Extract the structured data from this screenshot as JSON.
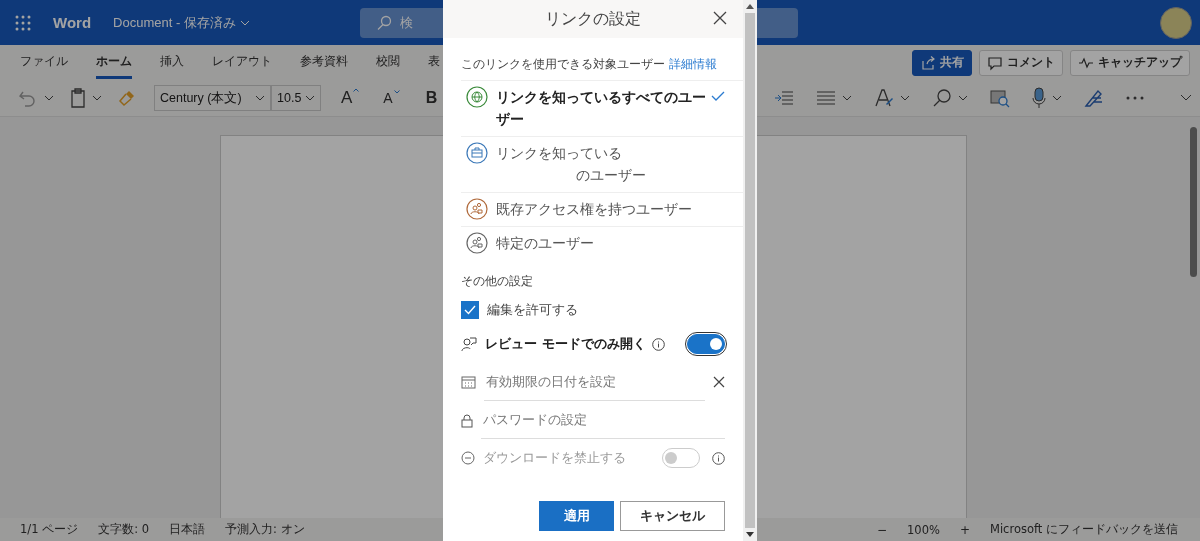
{
  "app": {
    "name": "Word",
    "document": "Document",
    "separator": "-",
    "status": "保存済み",
    "search_placeholder": "検"
  },
  "ribbon_tabs": [
    {
      "label": "ファイル",
      "selected": false
    },
    {
      "label": "ホーム",
      "selected": true
    },
    {
      "label": "挿入",
      "selected": false
    },
    {
      "label": "レイアウト",
      "selected": false
    },
    {
      "label": "参考資料",
      "selected": false
    },
    {
      "label": "校閲",
      "selected": false
    },
    {
      "label": "表",
      "selected": false
    }
  ],
  "ribbon_buttons": [
    {
      "label": "共有",
      "kind": "primary"
    },
    {
      "label": "コメント",
      "kind": "comment"
    },
    {
      "label": "キャッチアップ",
      "kind": "catchup"
    }
  ],
  "toolbar": {
    "font": "Century (本文)",
    "size": "10.5",
    "grow_font": "A",
    "shrink_font": "A",
    "bold": "B"
  },
  "dialog": {
    "title": "リンクの設定",
    "audience_label": "このリンクを使用できる対象ユーザー",
    "audience_link": "詳細情報",
    "audiences": [
      {
        "kind": "globe",
        "label": "リンクを知っているすべてのユーザー",
        "selected": true
      },
      {
        "kind": "org",
        "label": "リンクを知っている",
        "label_2": "のユーザー",
        "selected": false
      },
      {
        "kind": "existing",
        "label": "既存アクセス権を持つユーザー",
        "selected": false
      },
      {
        "kind": "specific",
        "label": "特定のユーザー",
        "selected": false
      }
    ],
    "other_title": "その他の設定",
    "allow_edit": {
      "label": "編集を許可する",
      "checked": true
    },
    "review_mode": {
      "label": "レビュー モードでのみ開く",
      "on": true
    },
    "expiry": {
      "placeholder": "有効期限の日付を設定"
    },
    "password": {
      "placeholder": "パスワードの設定"
    },
    "block_download": {
      "label": "ダウンロードを禁止する",
      "on": false,
      "disabled": true
    },
    "apply": "適用",
    "cancel": "キャンセル"
  },
  "status_bar": {
    "items": [
      "1/1 ページ",
      "文字数: 0",
      "日本語",
      "予測入力: オン"
    ],
    "zoom_out": "−",
    "zoom": "100%",
    "zoom_in": "+",
    "feedback": "Microsoft にフィードバックを送信"
  }
}
